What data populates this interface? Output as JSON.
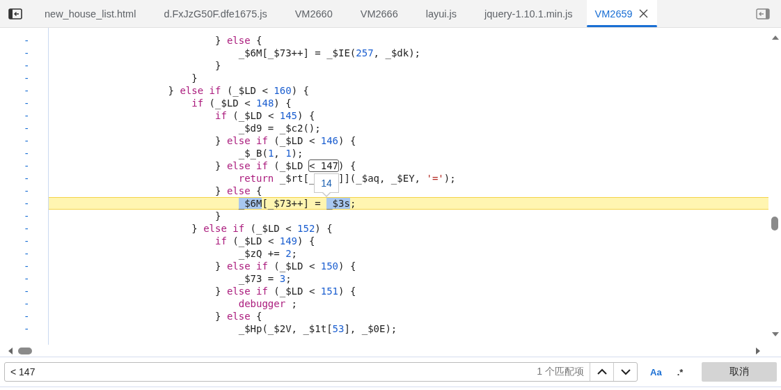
{
  "tabs": [
    {
      "label": "new_house_list.html",
      "selected": false
    },
    {
      "label": "d.FxJzG50F.dfe1675.js",
      "selected": false
    },
    {
      "label": "VM2660",
      "selected": false
    },
    {
      "label": "VM2666",
      "selected": false
    },
    {
      "label": "layui.js",
      "selected": false
    },
    {
      "label": "jquery-1.10.1.min.js",
      "selected": false
    },
    {
      "label": "VM2659",
      "selected": true
    }
  ],
  "code": {
    "lines": [
      {
        "marker": "-",
        "current": false,
        "tokens": [
          {
            "kind": "plain",
            "text": "                            } "
          },
          {
            "kind": "kw",
            "text": "else"
          },
          {
            "kind": "plain",
            "text": " {"
          }
        ]
      },
      {
        "marker": "-",
        "current": false,
        "tokens": [
          {
            "kind": "plain",
            "text": "                                _$6M[_$73++] = _$IE("
          },
          {
            "kind": "num",
            "text": "257"
          },
          {
            "kind": "plain",
            "text": ", _$dk);"
          }
        ]
      },
      {
        "marker": "-",
        "current": false,
        "tokens": [
          {
            "kind": "plain",
            "text": "                            }"
          }
        ]
      },
      {
        "marker": "-",
        "current": false,
        "tokens": [
          {
            "kind": "plain",
            "text": "                        }"
          }
        ]
      },
      {
        "marker": "-",
        "current": false,
        "tokens": [
          {
            "kind": "plain",
            "text": "                    } "
          },
          {
            "kind": "kw",
            "text": "else if"
          },
          {
            "kind": "plain",
            "text": " (_$LD < "
          },
          {
            "kind": "num",
            "text": "160"
          },
          {
            "kind": "plain",
            "text": ") {"
          }
        ]
      },
      {
        "marker": "-",
        "current": false,
        "tokens": [
          {
            "kind": "kw",
            "text": "                        if"
          },
          {
            "kind": "plain",
            "text": " (_$LD < "
          },
          {
            "kind": "num",
            "text": "148"
          },
          {
            "kind": "plain",
            "text": ") {"
          }
        ]
      },
      {
        "marker": "-",
        "current": false,
        "tokens": [
          {
            "kind": "kw",
            "text": "                            if"
          },
          {
            "kind": "plain",
            "text": " (_$LD < "
          },
          {
            "kind": "num",
            "text": "145"
          },
          {
            "kind": "plain",
            "text": ") {"
          }
        ]
      },
      {
        "marker": "-",
        "current": false,
        "tokens": [
          {
            "kind": "plain",
            "text": "                                _$d9 = _$c2();"
          }
        ]
      },
      {
        "marker": "-",
        "current": false,
        "tokens": [
          {
            "kind": "plain",
            "text": "                            } "
          },
          {
            "kind": "kw",
            "text": "else if"
          },
          {
            "kind": "plain",
            "text": " (_$LD < "
          },
          {
            "kind": "num",
            "text": "146"
          },
          {
            "kind": "plain",
            "text": ") {"
          }
        ]
      },
      {
        "marker": "-",
        "current": false,
        "tokens": [
          {
            "kind": "plain",
            "text": "                                _$_B("
          },
          {
            "kind": "num",
            "text": "1"
          },
          {
            "kind": "plain",
            "text": ", "
          },
          {
            "kind": "num",
            "text": "1"
          },
          {
            "kind": "plain",
            "text": ");"
          }
        ]
      },
      {
        "marker": "-",
        "current": false,
        "tokens": [
          {
            "kind": "plain",
            "text": "                            } "
          },
          {
            "kind": "kw",
            "text": "else if"
          },
          {
            "kind": "plain",
            "text": " (_$LD "
          },
          {
            "kind": "match",
            "text": "< 147"
          },
          {
            "kind": "plain",
            "text": ") {"
          }
        ]
      },
      {
        "marker": "-",
        "current": false,
        "tokens": [
          {
            "kind": "kw",
            "text": "                                return"
          },
          {
            "kind": "plain",
            "text": " _$rt[_"
          },
          {
            "kind": "after_tooltip",
            "text": "]](_$aq, _$EY, "
          },
          {
            "kind": "str",
            "text": "'='"
          },
          {
            "kind": "plain",
            "text": ");"
          }
        ]
      },
      {
        "marker": "-",
        "current": false,
        "tokens": [
          {
            "kind": "plain",
            "text": "                            } "
          },
          {
            "kind": "kw",
            "text": "else"
          },
          {
            "kind": "plain",
            "text": " {"
          }
        ]
      },
      {
        "marker": "-",
        "current": true,
        "tokens": [
          {
            "kind": "sel",
            "text": "                                _$6M"
          },
          {
            "kind": "plain",
            "text": "[_$73++] = "
          },
          {
            "kind": "sel",
            "text": "_$3s"
          },
          {
            "kind": "plain",
            "text": ";"
          }
        ]
      },
      {
        "marker": "-",
        "current": false,
        "tokens": [
          {
            "kind": "plain",
            "text": "                            }"
          }
        ]
      },
      {
        "marker": "-",
        "current": false,
        "tokens": [
          {
            "kind": "plain",
            "text": "                        } "
          },
          {
            "kind": "kw",
            "text": "else if"
          },
          {
            "kind": "plain",
            "text": " (_$LD < "
          },
          {
            "kind": "num",
            "text": "152"
          },
          {
            "kind": "plain",
            "text": ") {"
          }
        ]
      },
      {
        "marker": "-",
        "current": false,
        "tokens": [
          {
            "kind": "kw",
            "text": "                            if"
          },
          {
            "kind": "plain",
            "text": " (_$LD < "
          },
          {
            "kind": "num",
            "text": "149"
          },
          {
            "kind": "plain",
            "text": ") {"
          }
        ]
      },
      {
        "marker": "-",
        "current": false,
        "tokens": [
          {
            "kind": "plain",
            "text": "                                _$zQ += "
          },
          {
            "kind": "num",
            "text": "2"
          },
          {
            "kind": "plain",
            "text": ";"
          }
        ]
      },
      {
        "marker": "-",
        "current": false,
        "tokens": [
          {
            "kind": "plain",
            "text": "                            } "
          },
          {
            "kind": "kw",
            "text": "else if"
          },
          {
            "kind": "plain",
            "text": " (_$LD < "
          },
          {
            "kind": "num",
            "text": "150"
          },
          {
            "kind": "plain",
            "text": ") {"
          }
        ]
      },
      {
        "marker": "-",
        "current": false,
        "tokens": [
          {
            "kind": "plain",
            "text": "                                _$73 = "
          },
          {
            "kind": "num",
            "text": "3"
          },
          {
            "kind": "plain",
            "text": ";"
          }
        ]
      },
      {
        "marker": "-",
        "current": false,
        "tokens": [
          {
            "kind": "plain",
            "text": "                            } "
          },
          {
            "kind": "kw",
            "text": "else if"
          },
          {
            "kind": "plain",
            "text": " (_$LD < "
          },
          {
            "kind": "num",
            "text": "151"
          },
          {
            "kind": "plain",
            "text": ") {"
          }
        ]
      },
      {
        "marker": "-",
        "current": false,
        "tokens": [
          {
            "kind": "kw",
            "text": "                                debugger"
          },
          {
            "kind": "plain",
            "text": " ;"
          }
        ]
      },
      {
        "marker": "-",
        "current": false,
        "tokens": [
          {
            "kind": "plain",
            "text": "                            } "
          },
          {
            "kind": "kw",
            "text": "else"
          },
          {
            "kind": "plain",
            "text": " {"
          }
        ]
      },
      {
        "marker": "-",
        "current": false,
        "tokens": [
          {
            "kind": "plain",
            "text": "                                _$Hp(_$2V, _$1t["
          },
          {
            "kind": "num",
            "text": "53"
          },
          {
            "kind": "plain",
            "text": "], _$0E);"
          }
        ]
      }
    ],
    "tooltip": "14"
  },
  "search": {
    "value": "< 147",
    "match_count": "1 个匹配项",
    "options": [
      {
        "label": "Aa",
        "on": true
      },
      {
        "label": ".*",
        "on": false
      }
    ],
    "cancel": "取消"
  }
}
